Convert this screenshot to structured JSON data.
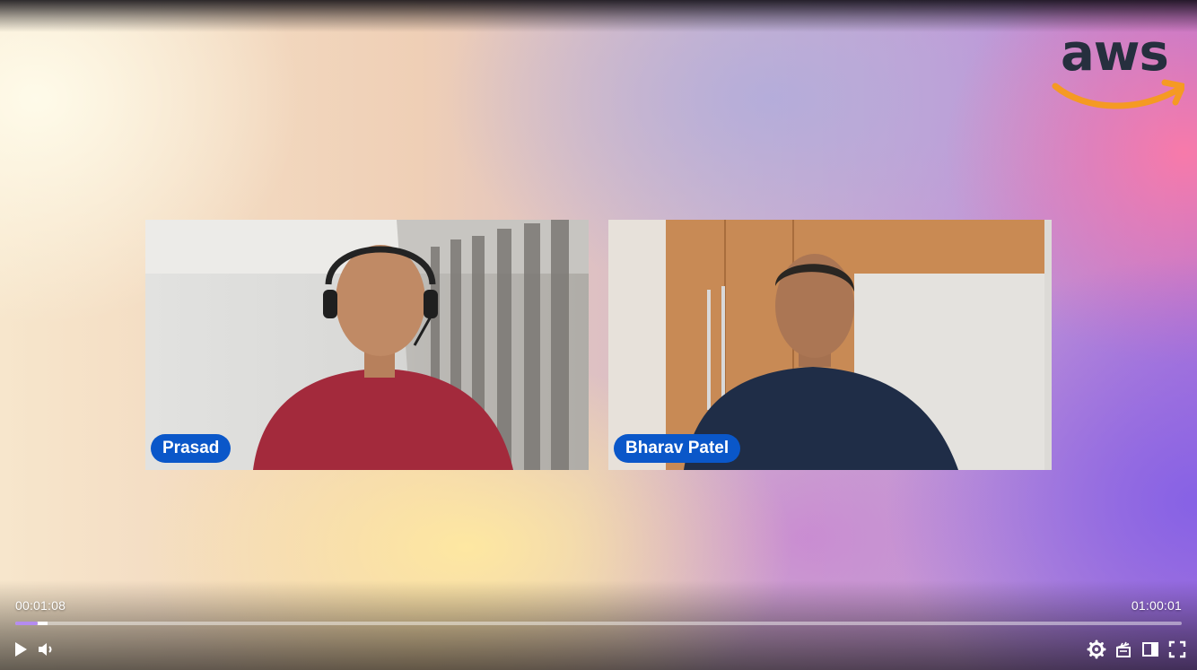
{
  "video": {
    "brand_logo_text": "aws",
    "brand_logo_colors": {
      "text": "#262f3e",
      "smile": "#f59a23"
    },
    "participants": [
      {
        "name": "Prasad"
      },
      {
        "name": "Bharav Patel"
      }
    ],
    "badge_color": "#0a57c9"
  },
  "player": {
    "current_time": "00:01:08",
    "total_time": "01:00:01",
    "progress_fraction": 0.019,
    "buffered_fraction": 0.028,
    "accent_color": "#b58cf0",
    "controls": {
      "left": [
        "play-icon",
        "volume-icon"
      ],
      "right": [
        "settings-gear-icon",
        "chapters-clapper-icon",
        "sidebar-panel-icon",
        "fullscreen-icon"
      ]
    }
  }
}
